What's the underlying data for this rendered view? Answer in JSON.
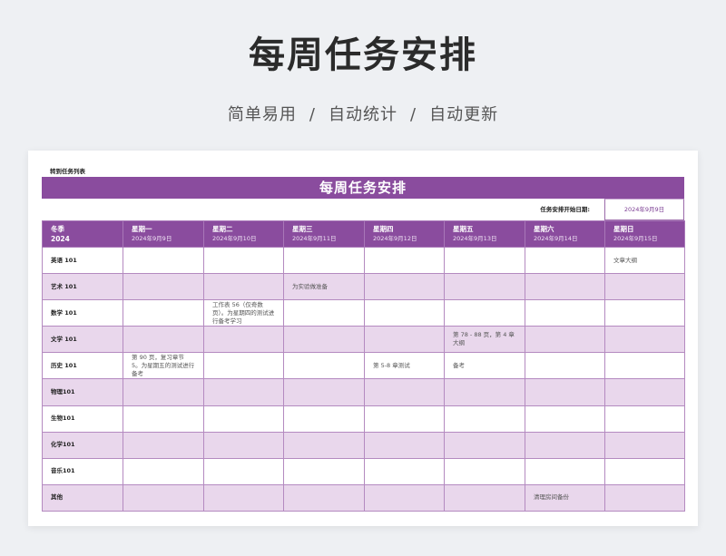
{
  "page": {
    "title": "每周任务安排",
    "subtitle_parts": [
      "简单易用",
      "自动统计",
      "自动更新"
    ],
    "separator": "/"
  },
  "sheet": {
    "jump_link": "转到任务列表",
    "banner_title": "每周任务安排",
    "start_label": "任务安排开始日期:",
    "start_date": "2024年9月9日",
    "header": {
      "term": "冬季",
      "year": "2024",
      "days": [
        {
          "day": "星期一",
          "date": "2024年9月9日"
        },
        {
          "day": "星期二",
          "date": "2024年9月10日"
        },
        {
          "day": "星期三",
          "date": "2024年9月11日"
        },
        {
          "day": "星期四",
          "date": "2024年9月12日"
        },
        {
          "day": "星期五",
          "date": "2024年9月13日"
        },
        {
          "day": "星期六",
          "date": "2024年9月14日"
        },
        {
          "day": "星期日",
          "date": "2024年9月15日"
        }
      ]
    },
    "rows": [
      {
        "subject": "英语 101",
        "cells": [
          "",
          "",
          "",
          "",
          "",
          "",
          "文章大纲"
        ]
      },
      {
        "subject": "艺术 101",
        "cells": [
          "",
          "",
          "为实验做准备",
          "",
          "",
          "",
          ""
        ]
      },
      {
        "subject": "数学 101",
        "cells": [
          "",
          "工作表 56（仅奇数页）。为星期四的测试进行备考学习",
          "",
          "",
          "",
          "",
          ""
        ]
      },
      {
        "subject": "文学 101",
        "cells": [
          "",
          "",
          "",
          "",
          "第 78 - 88 页，第 4 章大纲",
          "",
          ""
        ]
      },
      {
        "subject": "历史 101",
        "cells": [
          "第 90 页，复习章节 5。为星期五的测试进行备考",
          "",
          "",
          "第 5-8 章测试",
          "备考",
          "",
          ""
        ]
      },
      {
        "subject": "物理101",
        "cells": [
          "",
          "",
          "",
          "",
          "",
          "",
          ""
        ]
      },
      {
        "subject": "生物101",
        "cells": [
          "",
          "",
          "",
          "",
          "",
          "",
          ""
        ]
      },
      {
        "subject": "化学101",
        "cells": [
          "",
          "",
          "",
          "",
          "",
          "",
          ""
        ]
      },
      {
        "subject": "音乐101",
        "cells": [
          "",
          "",
          "",
          "",
          "",
          "",
          ""
        ]
      },
      {
        "subject": "其他",
        "cells": [
          "",
          "",
          "",
          "",
          "",
          "清理房间备份",
          ""
        ]
      }
    ]
  }
}
